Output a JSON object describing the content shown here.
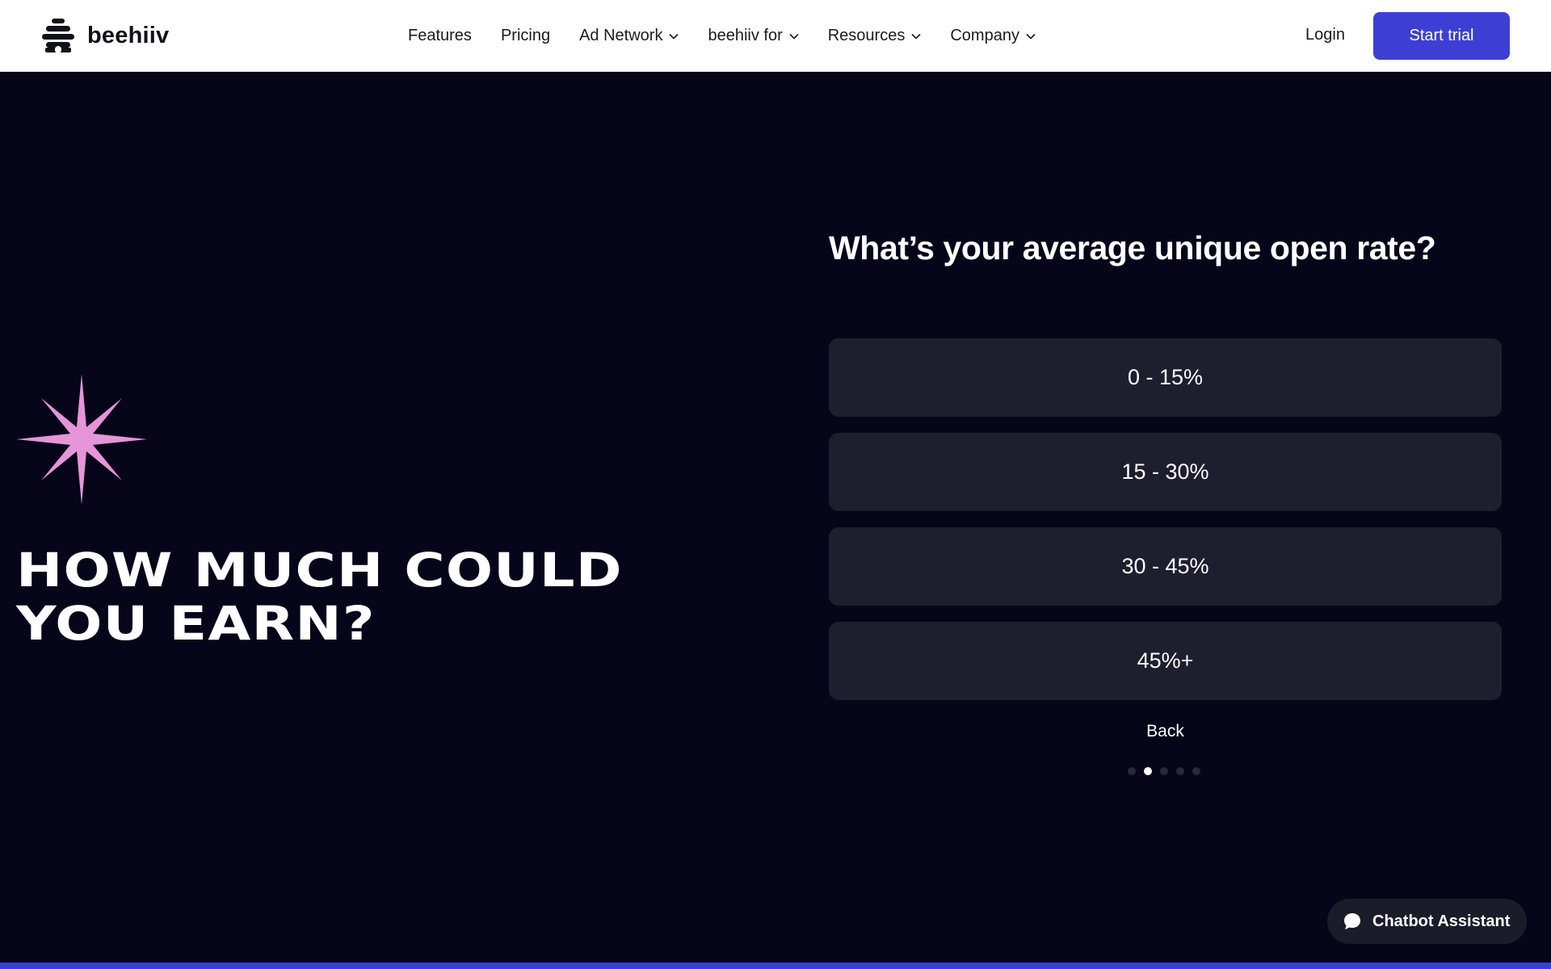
{
  "header": {
    "brand": "beehiiv",
    "nav": [
      {
        "label": "Features",
        "dropdown": false
      },
      {
        "label": "Pricing",
        "dropdown": false
      },
      {
        "label": "Ad Network",
        "dropdown": true
      },
      {
        "label": "beehiiv for",
        "dropdown": true
      },
      {
        "label": "Resources",
        "dropdown": true
      },
      {
        "label": "Company",
        "dropdown": true
      }
    ],
    "login": "Login",
    "cta": "Start trial"
  },
  "hero": {
    "headline_line1": "HOW MUCH COULD",
    "headline_line2": "YOU EARN?",
    "star_color": "#e595d8"
  },
  "quiz": {
    "question": "What’s your average unique open rate?",
    "options": [
      "0 - 15%",
      "15 - 30%",
      "30 - 45%",
      "45%+"
    ],
    "back": "Back",
    "steps_total": 5,
    "current_step": 2
  },
  "chatbot": {
    "label": "Chatbot Assistant"
  },
  "colors": {
    "background": "#07051a",
    "accent": "#3d3fd4",
    "option_bg": "#1f1e2e",
    "star": "#e595d8"
  }
}
